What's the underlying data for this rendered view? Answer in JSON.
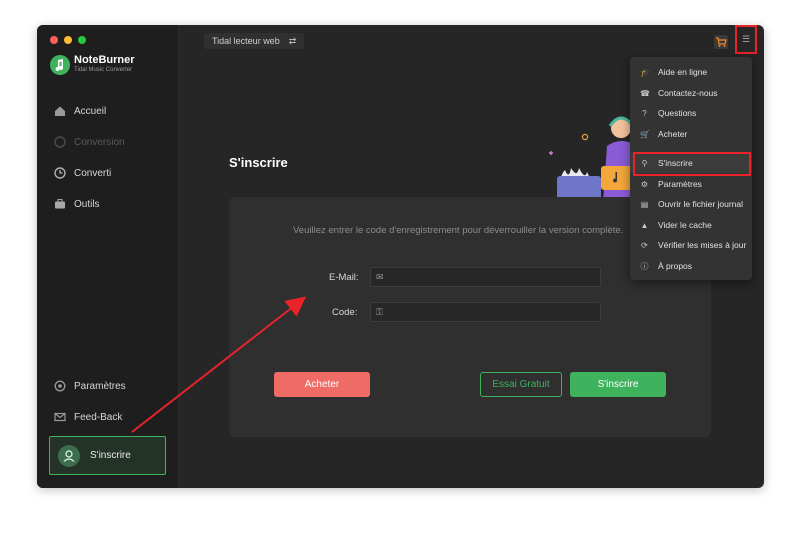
{
  "app": {
    "name": "NoteBurner",
    "subtitle": "Tidal Music Converter"
  },
  "sidebar": {
    "items": [
      {
        "label": "Accueil",
        "icon": "home-icon"
      },
      {
        "label": "Conversion",
        "icon": "conversion-icon"
      },
      {
        "label": "Converti",
        "icon": "clock-icon"
      },
      {
        "label": "Outils",
        "icon": "toolbox-icon"
      }
    ],
    "bottom": [
      {
        "label": "Paramètres",
        "icon": "gear-icon"
      },
      {
        "label": "Feed-Back",
        "icon": "mail-icon"
      }
    ],
    "signup_label": "S'inscrire"
  },
  "toolbar": {
    "source_label": "Tidal lecteur web",
    "swap_icon": "⇄",
    "menu_icon": "☰"
  },
  "main": {
    "title": "S'inscrire",
    "message": "Veuillez entrer le code d'enregistrement pour déverrouiller la version complète.",
    "email_label": "E-Mail:",
    "code_label": "Code:",
    "email_value": "",
    "code_value": "",
    "buy_label": "Acheter",
    "trial_label": "Essai Gratuit",
    "register_label": "S'inscrire"
  },
  "menu": {
    "items": [
      {
        "label": "Aide en ligne",
        "icon": "graduation-cap-icon"
      },
      {
        "label": "Contactez-nous",
        "icon": "phone-icon"
      },
      {
        "label": "Questions",
        "icon": "question-icon"
      },
      {
        "label": "Acheter",
        "icon": "cart-icon"
      },
      {
        "label": "S'inscrire",
        "icon": "user-key-icon"
      },
      {
        "label": "Paramètres",
        "icon": "gear-icon"
      },
      {
        "label": "Ouvrir le fichier journal",
        "icon": "file-icon"
      },
      {
        "label": "Vider le cache",
        "icon": "broom-icon"
      },
      {
        "label": "Vérifier les mises à jour",
        "icon": "refresh-icon"
      },
      {
        "label": "À propos",
        "icon": "info-icon"
      }
    ]
  },
  "colors": {
    "accent": "#3fb25e",
    "buy": "#ef6b65",
    "highlight": "#e8232a"
  }
}
